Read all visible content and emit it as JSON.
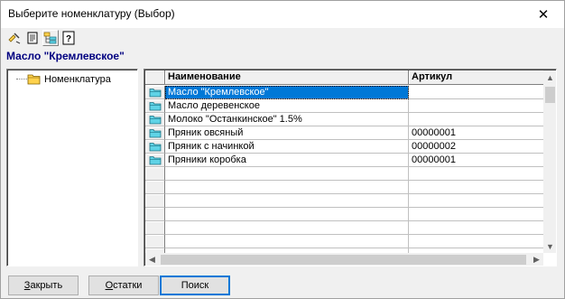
{
  "window": {
    "title": "Выберите номенклатуру (Выбор)",
    "close_glyph": "✕"
  },
  "toolbar": {
    "icons": [
      "select-item-icon",
      "open-item-icon",
      "tree-view-icon",
      "help-icon"
    ],
    "help_glyph": "?"
  },
  "selected_item": "Масло \"Кремлевское\"",
  "tree": {
    "root_label": "Номенклатура"
  },
  "grid": {
    "columns": [
      "Наименование",
      "Артикул"
    ],
    "rows": [
      {
        "name": "Масло \"Кремлевское\"",
        "article": "",
        "selected": true
      },
      {
        "name": "Масло деревенское",
        "article": ""
      },
      {
        "name": "Молоко \"Останкинское\" 1.5%",
        "article": ""
      },
      {
        "name": "Пряник овсяный",
        "article": "00000001"
      },
      {
        "name": "Пряник с начинкой",
        "article": "00000002"
      },
      {
        "name": "Пряники коробка",
        "article": "00000001"
      }
    ],
    "empty_rows": 7
  },
  "buttons": {
    "close": {
      "mnemonic": "З",
      "rest": "акрыть"
    },
    "stock": {
      "mnemonic": "О",
      "rest": "статки"
    },
    "search": {
      "label": "Поиск"
    }
  },
  "colors": {
    "selection": "#0078d7",
    "title_accent": "#000080",
    "folder_icon": "#5fd3e6"
  }
}
